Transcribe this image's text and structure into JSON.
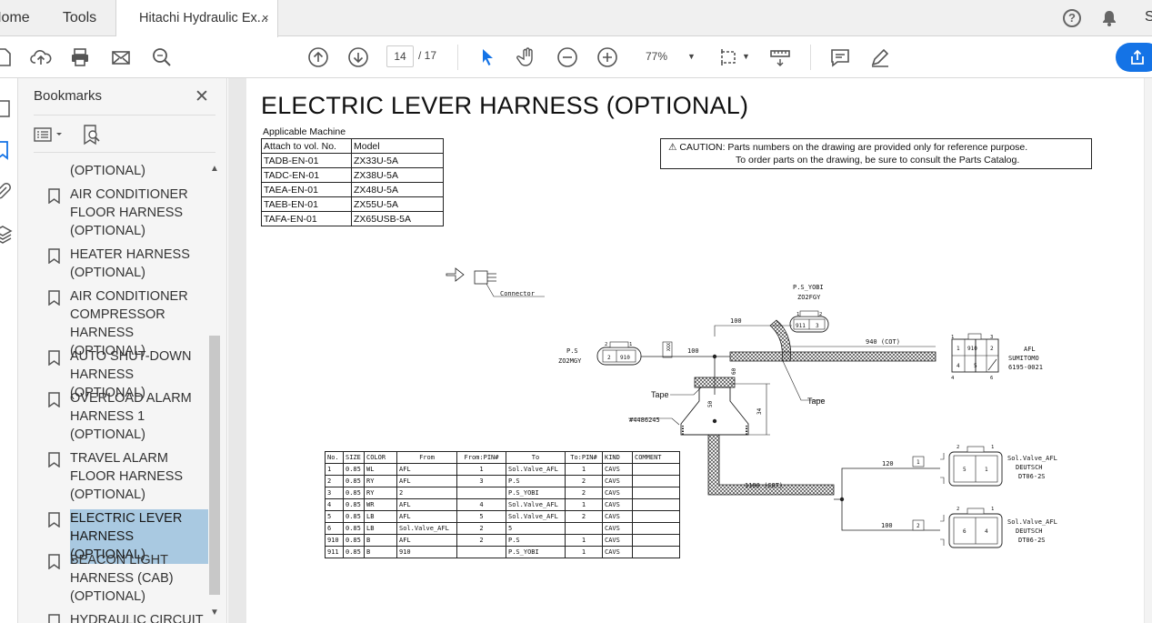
{
  "tabs": {
    "home": "Home",
    "tools": "Tools",
    "document": "Hitachi Hydraulic Ex...",
    "close": "×"
  },
  "user_initial": "S",
  "toolbar": {
    "page_current": "14",
    "page_total": "/ 17",
    "zoom": "77%"
  },
  "sidebar": {
    "title": "Bookmarks",
    "items": [
      {
        "label": "(OPTIONAL)"
      },
      {
        "label": "AIR CONDITIONER FLOOR HARNESS (OPTIONAL)"
      },
      {
        "label": "HEATER HARNESS (OPTIONAL)"
      },
      {
        "label": "AIR CONDITIONER COMPRESSOR HARNESS (OPTIONAL)"
      },
      {
        "label": "AUTO SHUT-DOWN HARNESS (OPTIONAL)"
      },
      {
        "label": "OVERLOAD ALARM HARNESS 1 (OPTIONAL)"
      },
      {
        "label": "TRAVEL ALARM FLOOR HARNESS (OPTIONAL)"
      },
      {
        "label": "ELECTRIC LEVER HARNESS (OPTIONAL)",
        "selected": true
      },
      {
        "label": "BEACON LIGHT HARNESS (CAB) (OPTIONAL)"
      },
      {
        "label": "HYDRAULIC CIRCUIT"
      }
    ]
  },
  "document": {
    "title": "ELECTRIC LEVER HARNESS (OPTIONAL)",
    "applicable_label": "Applicable Machine",
    "machine_table": {
      "headers": [
        "Attach to vol. No.",
        "Model"
      ],
      "rows": [
        [
          "TADB-EN-01",
          "ZX33U-5A"
        ],
        [
          "TADC-EN-01",
          "ZX38U-5A"
        ],
        [
          "TAEA-EN-01",
          "ZX48U-5A"
        ],
        [
          "TAEB-EN-01",
          "ZX55U-5A"
        ],
        [
          "TAFA-EN-01",
          "ZX65USB-5A"
        ]
      ]
    },
    "caution_line1": "CAUTION: Parts numbers on the drawing are provided only for reference purpose.",
    "caution_line2": "To order parts on the drawing, be sure to consult the Parts Catalog.",
    "diagram": {
      "connector_label": "Connector",
      "ps_yobi_label": "P.S_YOBI",
      "ps_yobi_part": "ZO2FGY",
      "ps_label": "P.S",
      "ps_part": "ZO2MGY",
      "dim_100_top": "100",
      "dim_100_left": "100",
      "dim_940": "940 (COT)",
      "dim_60": "60",
      "dim_50": "50",
      "dim_34": "34",
      "dim_1180": "1180 (COT)",
      "dim_120": "120",
      "dim_100_bottom": "100",
      "tape_left": "Tape",
      "tape_right": "Tape",
      "grommet": "#4486245",
      "afl_label": "AFL",
      "afl_maker": "SUMITOMO",
      "afl_part": "6195-0021",
      "sol1_label": "Sol.Valve_AFL",
      "sol1_maker": "DEUTSCH",
      "sol1_part": "DT06-2S",
      "sol2_label": "Sol.Valve_AFL",
      "sol2_maker": "DEUTSCH",
      "sol2_part": "DT06-2S",
      "tag_1": "1",
      "tag_2": "2"
    },
    "wire_table": {
      "headers": [
        "No.",
        "SIZE",
        "COLOR",
        "From",
        "From:PIN#",
        "To",
        "To:PIN#",
        "KIND",
        "COMMENT"
      ],
      "rows": [
        [
          "1",
          "0.85",
          "WL",
          "AFL",
          "1",
          "Sol.Valve_AFL",
          "1",
          "CAVS",
          ""
        ],
        [
          "2",
          "0.85",
          "RY",
          "AFL",
          "3",
          "P.S",
          "2",
          "CAVS",
          ""
        ],
        [
          "3",
          "0.85",
          "RY",
          "2",
          "",
          "P.S_YOBI",
          "2",
          "CAVS",
          ""
        ],
        [
          "4",
          "0.85",
          "WR",
          "AFL",
          "4",
          "Sol.Valve_AFL",
          "1",
          "CAVS",
          ""
        ],
        [
          "5",
          "0.85",
          "LB",
          "AFL",
          "5",
          "Sol.Valve_AFL",
          "2",
          "CAVS",
          ""
        ],
        [
          "6",
          "0.85",
          "LB",
          "Sol.Valve_AFL",
          "2",
          "5",
          "",
          "CAVS",
          ""
        ],
        [
          "910",
          "0.85",
          "B",
          "AFL",
          "2",
          "P.S",
          "1",
          "CAVS",
          ""
        ],
        [
          "911",
          "0.85",
          "B",
          "910",
          "",
          "P.S_YOBI",
          "1",
          "CAVS",
          ""
        ]
      ]
    }
  }
}
